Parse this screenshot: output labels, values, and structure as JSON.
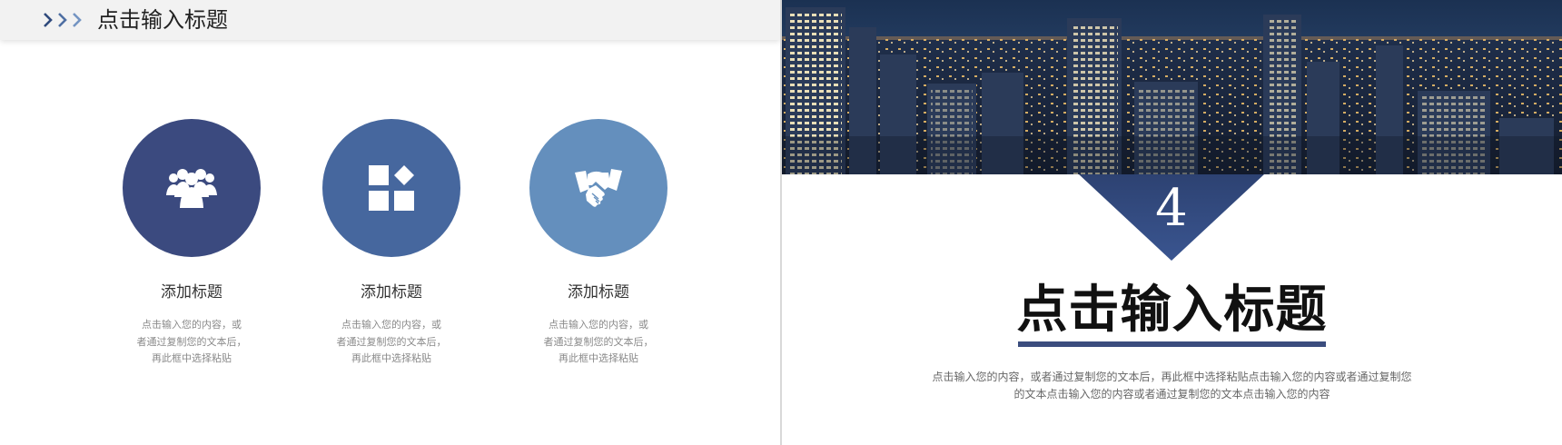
{
  "left_slide": {
    "header": {
      "title": "点击输入标题"
    },
    "features": [
      {
        "title": "添加标题",
        "desc": [
          "点击输入您的内容，或",
          "者通过复制您的文本后，",
          "再此框中选择粘贴"
        ],
        "color": "#3b4a7f",
        "icon": "people-group-icon"
      },
      {
        "title": "添加标题",
        "desc": [
          "点击输入您的内容，或",
          "者通过复制您的文本后，",
          "再此框中选择粘贴"
        ],
        "color": "#46679e",
        "icon": "shapes-grid-icon"
      },
      {
        "title": "添加标题",
        "desc": [
          "点击输入您的内容，或",
          "者通过复制您的文本后，",
          "再此框中选择粘贴"
        ],
        "color": "#648fbd",
        "icon": "handshake-icon"
      }
    ]
  },
  "right_slide": {
    "section_number": "4",
    "title": "点击输入标题",
    "body": [
      "点击输入您的内容，或者通过复制您的文本后，再此框中选择粘贴点击输入您的内容或者通过复制您",
      "的文本点击输入您的内容或者通过复制您的文本点击输入您的内容"
    ],
    "accent_color": "#3b4d7e"
  }
}
